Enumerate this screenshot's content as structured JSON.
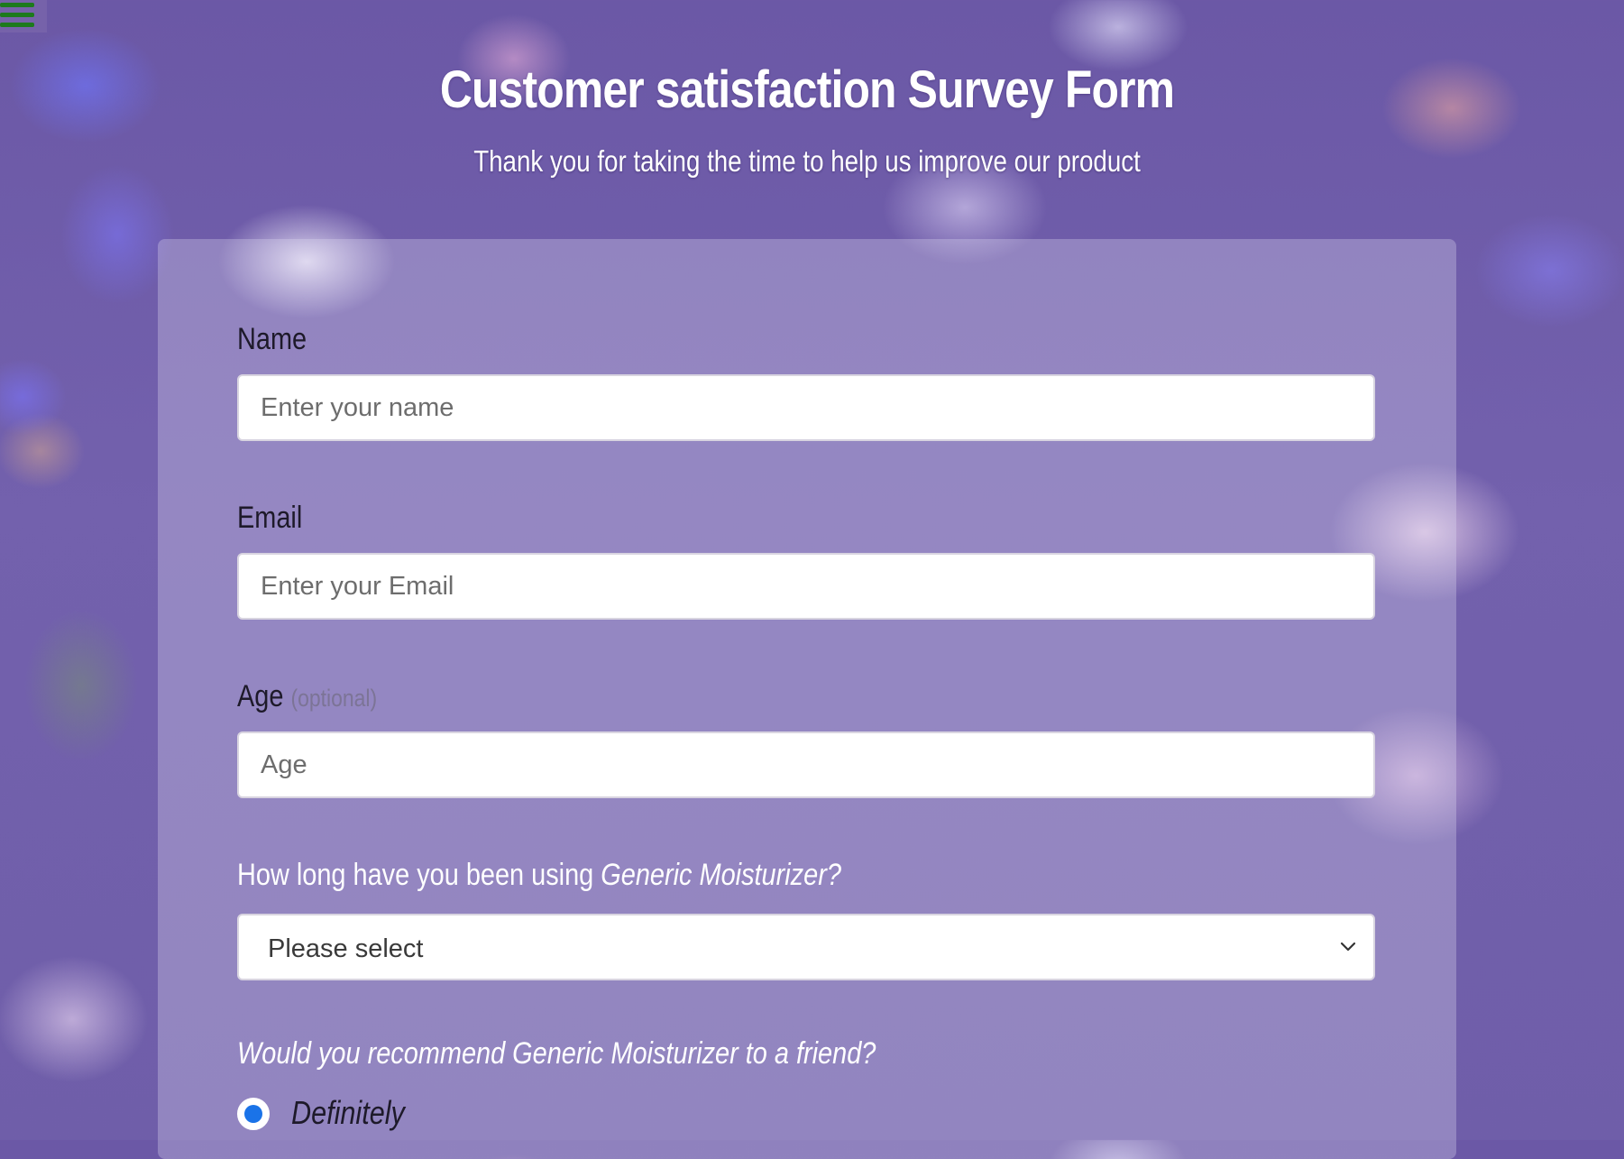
{
  "header": {
    "title": "Customer satisfaction Survey Form",
    "subtitle": "Thank you for taking the time to help us improve our product"
  },
  "form": {
    "name": {
      "label": "Name",
      "placeholder": "Enter your name",
      "value": ""
    },
    "email": {
      "label": "Email",
      "placeholder": "Enter your Email",
      "value": ""
    },
    "age": {
      "label": "Age",
      "optional_note": "(optional)",
      "placeholder": "Age",
      "value": ""
    },
    "usage_duration": {
      "label_prefix": "How long have you been using ",
      "label_product": "Generic Moisturizer?",
      "selected": "Please select"
    },
    "recommend": {
      "question": "Would you recommend Generic Moisturizer to a friend?",
      "options": [
        {
          "label": "Definitely",
          "selected": true
        }
      ]
    }
  },
  "colors": {
    "accent_radio": "#1a73e8",
    "menu_icon": "#1d7a1d"
  },
  "icons": {
    "menu": "hamburger-icon",
    "select": "chevron-down-icon"
  }
}
